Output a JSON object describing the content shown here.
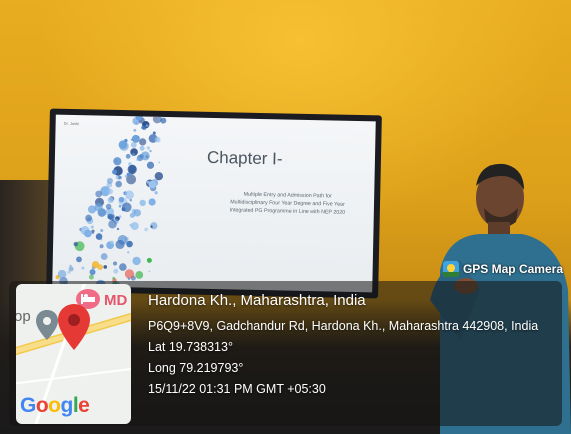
{
  "slide": {
    "corner": "Dr. Joshi",
    "title": "Chapter I-",
    "subtitle_lines": [
      "Multiple Entry and Admission Path for",
      "Multidisciplinary Four Year Degree and Five Year",
      "Integrated PG Programme in Line with NEP 2020"
    ]
  },
  "app_badge": {
    "name": "GPS Map Camera",
    "icon": "gps-map-camera-icon"
  },
  "map": {
    "logo": "Google",
    "poi_label": "MD",
    "partial_label": "op",
    "pin_icon": "map-pin-icon",
    "poi_icon": "hotel-icon"
  },
  "location": {
    "title": "Hardona Kh., Maharashtra, India",
    "address": "P6Q9+8V9, Gadchandur Rd, Hardona Kh., Maharashtra 442908, India",
    "lat": "Lat 19.738313°",
    "long": "Long 79.219793°",
    "datetime": "15/11/22 01:31 PM GMT +05:30"
  },
  "colors": {
    "wall": "#dda01a",
    "overlay": "#141414",
    "pin": "#e53935",
    "badge_text": "#ffffff"
  }
}
